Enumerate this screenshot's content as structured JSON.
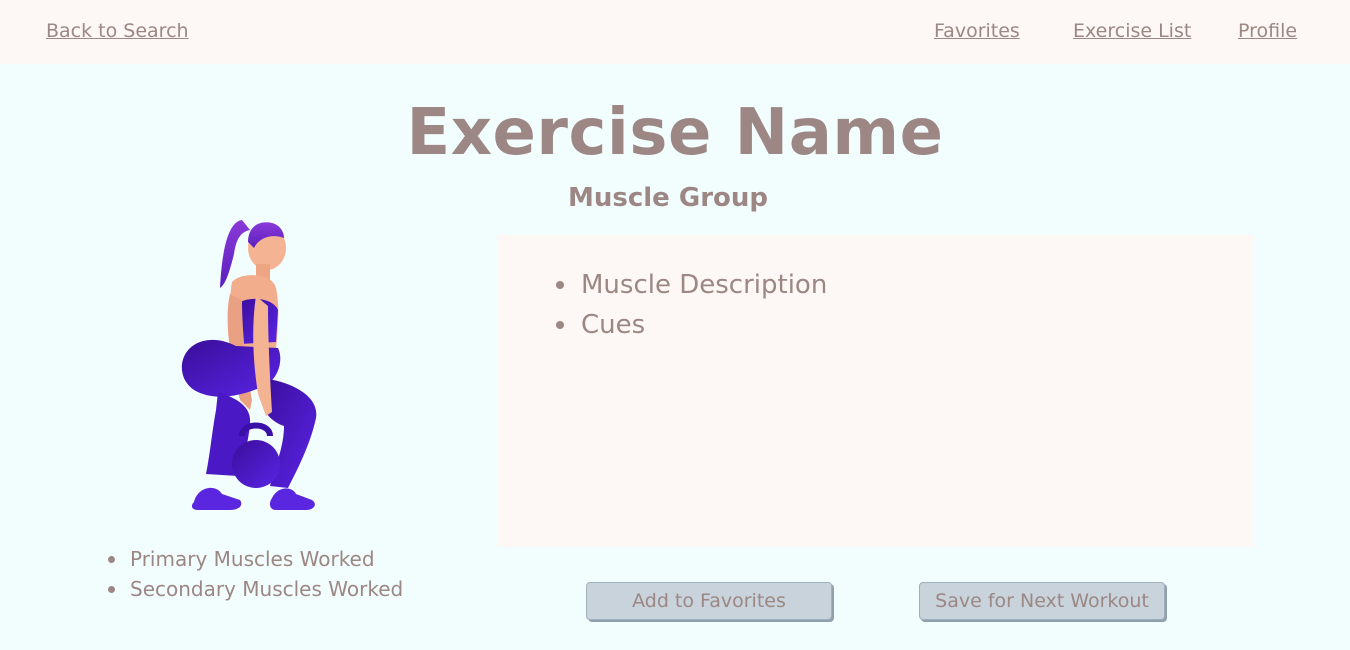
{
  "nav": {
    "back_label": "Back to Search",
    "favorites_label": "Favorites",
    "exercise_list_label": "Exercise List",
    "profile_label": "Profile"
  },
  "exercise": {
    "title": "Exercise Name",
    "muscle_group": "Muscle Group",
    "details": [
      "Muscle Description",
      "Cues"
    ],
    "muscles_worked": [
      "Primary Muscles Worked",
      "Secondary Muscles Worked"
    ]
  },
  "actions": {
    "add_favorites_label": "Add to Favorites",
    "save_next_label": "Save for Next Workout"
  },
  "colors": {
    "page_background": "#f2fdfe",
    "panel_background": "#fdf8f5",
    "text": "#9c8784",
    "button": "#c8d3dc",
    "figure_purple": "#4b18c8"
  }
}
